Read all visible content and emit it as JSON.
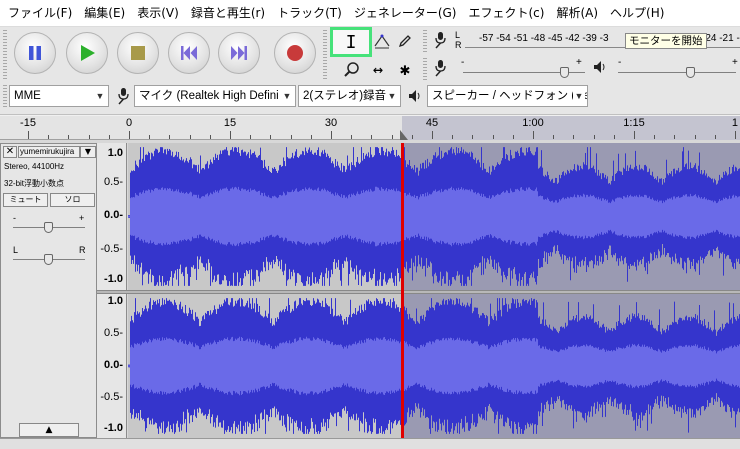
{
  "menu": [
    "ファイル(F)",
    "編集(E)",
    "表示(V)",
    "録音と再生(r)",
    "トラック(T)",
    "ジェネレーター(G)",
    "エフェクト(c)",
    "解析(A)",
    "ヘルプ(H)"
  ],
  "transport": {
    "pause": "pause-icon",
    "play": "play-icon",
    "stop": "stop-icon",
    "skip_start": "skip-to-start-icon",
    "skip_end": "skip-to-end-icon",
    "record": "record-icon"
  },
  "tools": {
    "selection": "I",
    "envelope": "envelope-tool-icon",
    "draw": "pencil-icon",
    "zoom": "zoom-icon",
    "timeshift": "↔",
    "multi": "✱"
  },
  "meters": {
    "record_lr": [
      "L",
      "R"
    ],
    "scale": "-57 -54 -51 -48 -45 -42 -39 -3",
    "scale_tail": "-24 -21 -1",
    "monitor_button": "モニターを開始",
    "slider_minus": "-",
    "slider_plus": "+",
    "record_level": 0.84,
    "playback_level": 0.62
  },
  "devices": {
    "host": "MME",
    "input": "マイク (Realtek High Defini",
    "channels": "2(ステレオ)録音チ",
    "output": "スピーカー / ヘッドフォン (Rea"
  },
  "timeline": {
    "ticks": [
      {
        "label": "-15",
        "t": -15
      },
      {
        "label": "0",
        "t": 0
      },
      {
        "label": "15",
        "t": 15
      },
      {
        "label": "30",
        "t": 30
      },
      {
        "label": "45",
        "t": 45
      },
      {
        "label": "1:00",
        "t": 60
      },
      {
        "label": "1:15",
        "t": 75
      },
      {
        "label": "1",
        "t": 90
      }
    ],
    "selection_start": 41.5
  },
  "track": {
    "name": "yumemirukujira",
    "info_rate": "Stereo, 44100Hz",
    "info_format": "32-bit浮動小数点",
    "mute": "ミュート",
    "solo": "ソロ",
    "gain_minus": "-",
    "gain_plus": "+",
    "pan_left": "L",
    "pan_right": "R",
    "gain_level": 0.5,
    "pan_level": 0.5,
    "scale_labels": [
      "1.0",
      "0.5-",
      "0.0-",
      "-0.5-",
      "-1.0"
    ]
  },
  "colors": {
    "wave_peak": "#3535cc",
    "wave_rms": "#6a6ae8",
    "cursor": "#e00000",
    "tool_selected": "#46e27a"
  }
}
